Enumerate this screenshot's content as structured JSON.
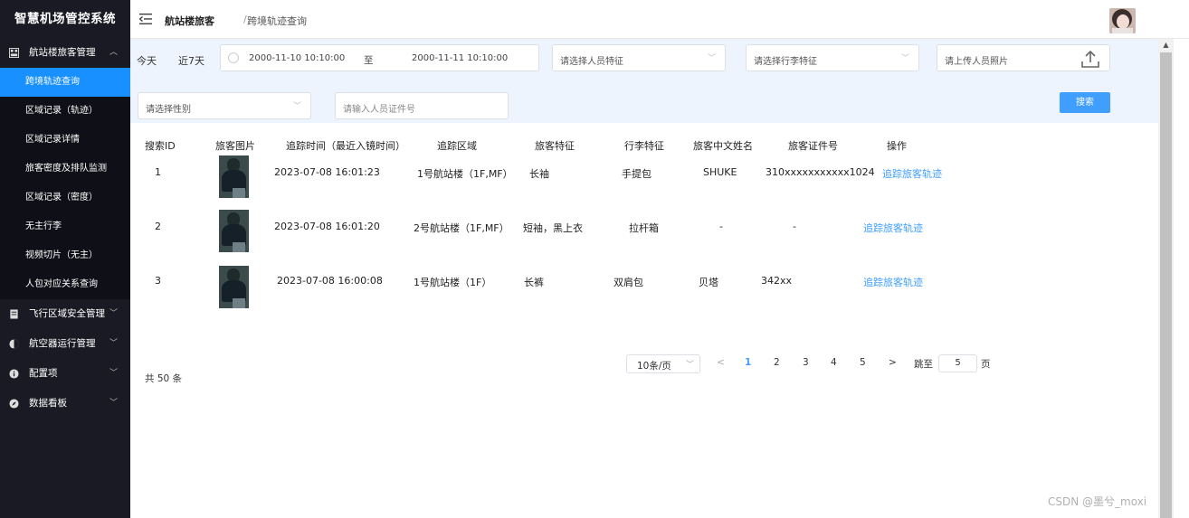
{
  "app": {
    "title": "智慧机场管控系统"
  },
  "sidebar": {
    "groups": [
      {
        "label": "航站楼旅客管理",
        "expanded": true
      },
      {
        "label": "飞行区域安全管理"
      },
      {
        "label": "航空器运行管理"
      },
      {
        "label": "配置项"
      },
      {
        "label": "数据看板"
      }
    ],
    "sub_items": [
      {
        "label": "跨境轨迹查询",
        "active": true
      },
      {
        "label": "区域记录（轨迹）"
      },
      {
        "label": "区域记录详情"
      },
      {
        "label": "旅客密度及排队监测"
      },
      {
        "label": "区域记录（密度）"
      },
      {
        "label": "无主行李"
      },
      {
        "label": "视频切片（无主）"
      },
      {
        "label": "人包对应关系查询"
      }
    ]
  },
  "header": {
    "breadcrumb_1": "航站楼旅客",
    "breadcrumb_sep": "/",
    "breadcrumb_2": "跨境轨迹查询"
  },
  "filters": {
    "today": "今天",
    "last7": "近7天",
    "date_start": "2000-11-10 10:10:00",
    "date_to": "至",
    "date_end": "2000-11-11 10:10:00",
    "person_feature_placeholder": "请选择人员特征",
    "luggage_feature_placeholder": "请选择行李特征",
    "upload_placeholder": "请上传人员照片",
    "gender_placeholder": "请选择性别",
    "id_placeholder": "请输入人员证件号",
    "search_label": "搜索"
  },
  "table": {
    "headers": [
      "搜索ID",
      "旅客图片",
      "追踪时间（最近入镜时间）",
      "追踪区域",
      "旅客特征",
      "行李特征",
      "旅客中文姓名",
      "旅客证件号",
      "操作"
    ],
    "rows": [
      {
        "id": "1",
        "time": "2023-07-08 16:01:23",
        "area": "1号航站楼（1F,MF）",
        "feature": "长袖",
        "luggage": "手提包",
        "name": "SHUKE",
        "cert": "310xxxxxxxxxxx1024",
        "action": "追踪旅客轨迹"
      },
      {
        "id": "2",
        "time": "2023-07-08 16:01:20",
        "area": "2号航站楼（1F,MF）",
        "feature": "短袖，黑上衣",
        "luggage": "拉杆箱",
        "name": "-",
        "cert": "-",
        "action": "追踪旅客轨迹"
      },
      {
        "id": "3",
        "time": "2023-07-08 16:00:08",
        "area": "1号航站楼（1F）",
        "feature": "长裤",
        "luggage": "双肩包",
        "name": "贝塔",
        "cert": "342xx",
        "action": "追踪旅客轨迹"
      }
    ]
  },
  "pagination": {
    "total": "共 50 条",
    "page_size": "10条/页",
    "prev": "<",
    "pages": [
      "1",
      "2",
      "3",
      "4",
      "5"
    ],
    "current": "1",
    "next": ">",
    "jump_label": "跳至",
    "jump_value": "5",
    "page_unit": "页"
  },
  "watermark": "CSDN @墨兮_moxi",
  "colors": {
    "sidebar_bg": "#191a23",
    "active": "#1890ff",
    "link": "#409eff",
    "filter_bg": "#eef4fd"
  }
}
